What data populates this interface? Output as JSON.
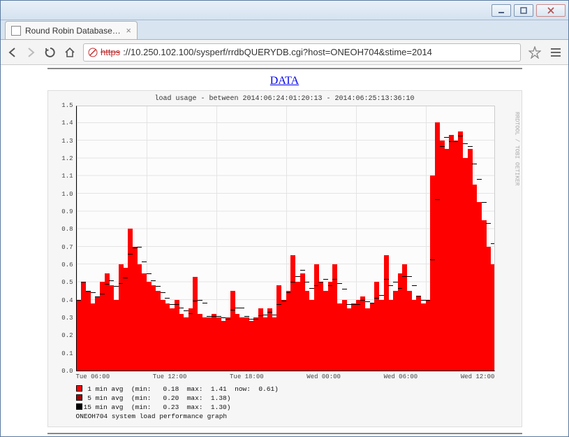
{
  "window": {
    "tab_title": "Round Robin Database Qu",
    "url_scheme": "https",
    "url_rest": "://10.250.102.100/sysperf/rrdbQUERYDB.cgi?host=ONEOH704&stime=2014"
  },
  "page": {
    "data_link_label": "DATA"
  },
  "chart_data": {
    "type": "area",
    "title": "load usage - between 2014:06:24:01:20:13 - 2014:06:25:13:36:10",
    "ylabel": "",
    "ylim": [
      0,
      1.5
    ],
    "yticks": [
      0.0,
      0.1,
      0.2,
      0.3,
      0.4,
      0.5,
      0.6,
      0.7,
      0.8,
      0.9,
      1.0,
      1.1,
      1.2,
      1.3,
      1.4,
      1.5
    ],
    "x_categories": [
      "Tue 06:00",
      "Tue 12:00",
      "Tue 18:00",
      "Wed 00:00",
      "Wed 06:00",
      "Wed 12:00"
    ],
    "series": [
      {
        "name": "1 min avg",
        "role": "area",
        "color": "#ff0000",
        "min": 0.18,
        "max": 1.41,
        "now": 0.61,
        "values": [
          0.4,
          0.5,
          0.45,
          0.38,
          0.42,
          0.5,
          0.55,
          0.48,
          0.4,
          0.6,
          0.58,
          0.8,
          0.7,
          0.6,
          0.55,
          0.5,
          0.48,
          0.45,
          0.4,
          0.38,
          0.35,
          0.4,
          0.32,
          0.3,
          0.35,
          0.53,
          0.32,
          0.3,
          0.3,
          0.32,
          0.3,
          0.28,
          0.3,
          0.45,
          0.32,
          0.3,
          0.3,
          0.28,
          0.3,
          0.35,
          0.3,
          0.35,
          0.3,
          0.48,
          0.4,
          0.45,
          0.65,
          0.5,
          0.55,
          0.45,
          0.4,
          0.6,
          0.5,
          0.45,
          0.5,
          0.6,
          0.38,
          0.4,
          0.35,
          0.38,
          0.4,
          0.42,
          0.35,
          0.38,
          0.5,
          0.4,
          0.65,
          0.4,
          0.45,
          0.55,
          0.6,
          0.45,
          0.4,
          0.42,
          0.38,
          0.4,
          1.1,
          1.4,
          1.3,
          1.25,
          1.33,
          1.3,
          1.35,
          1.2,
          1.25,
          1.05,
          0.95,
          0.85,
          0.7,
          0.6
        ]
      },
      {
        "name": "5 min avg",
        "role": "line",
        "color": "#a00000",
        "min": 0.2,
        "max": 1.38
      },
      {
        "name": "15 min avg",
        "role": "line",
        "color": "#000000",
        "min": 0.23,
        "max": 1.3
      }
    ],
    "footer": "ONEOH704 system load performance graph",
    "watermark": "RRDTOOL / TOBI OETIKER"
  },
  "legend": {
    "l1": " 1 min avg  (min:   0.18  max:  1.41  now:  0.61)",
    "l2": " 5 min avg  (min:   0.20  max:  1.38)",
    "l3": "15 min avg  (min:   0.23  max:  1.30)",
    "l4": "ONEOH704 system load performance graph"
  }
}
